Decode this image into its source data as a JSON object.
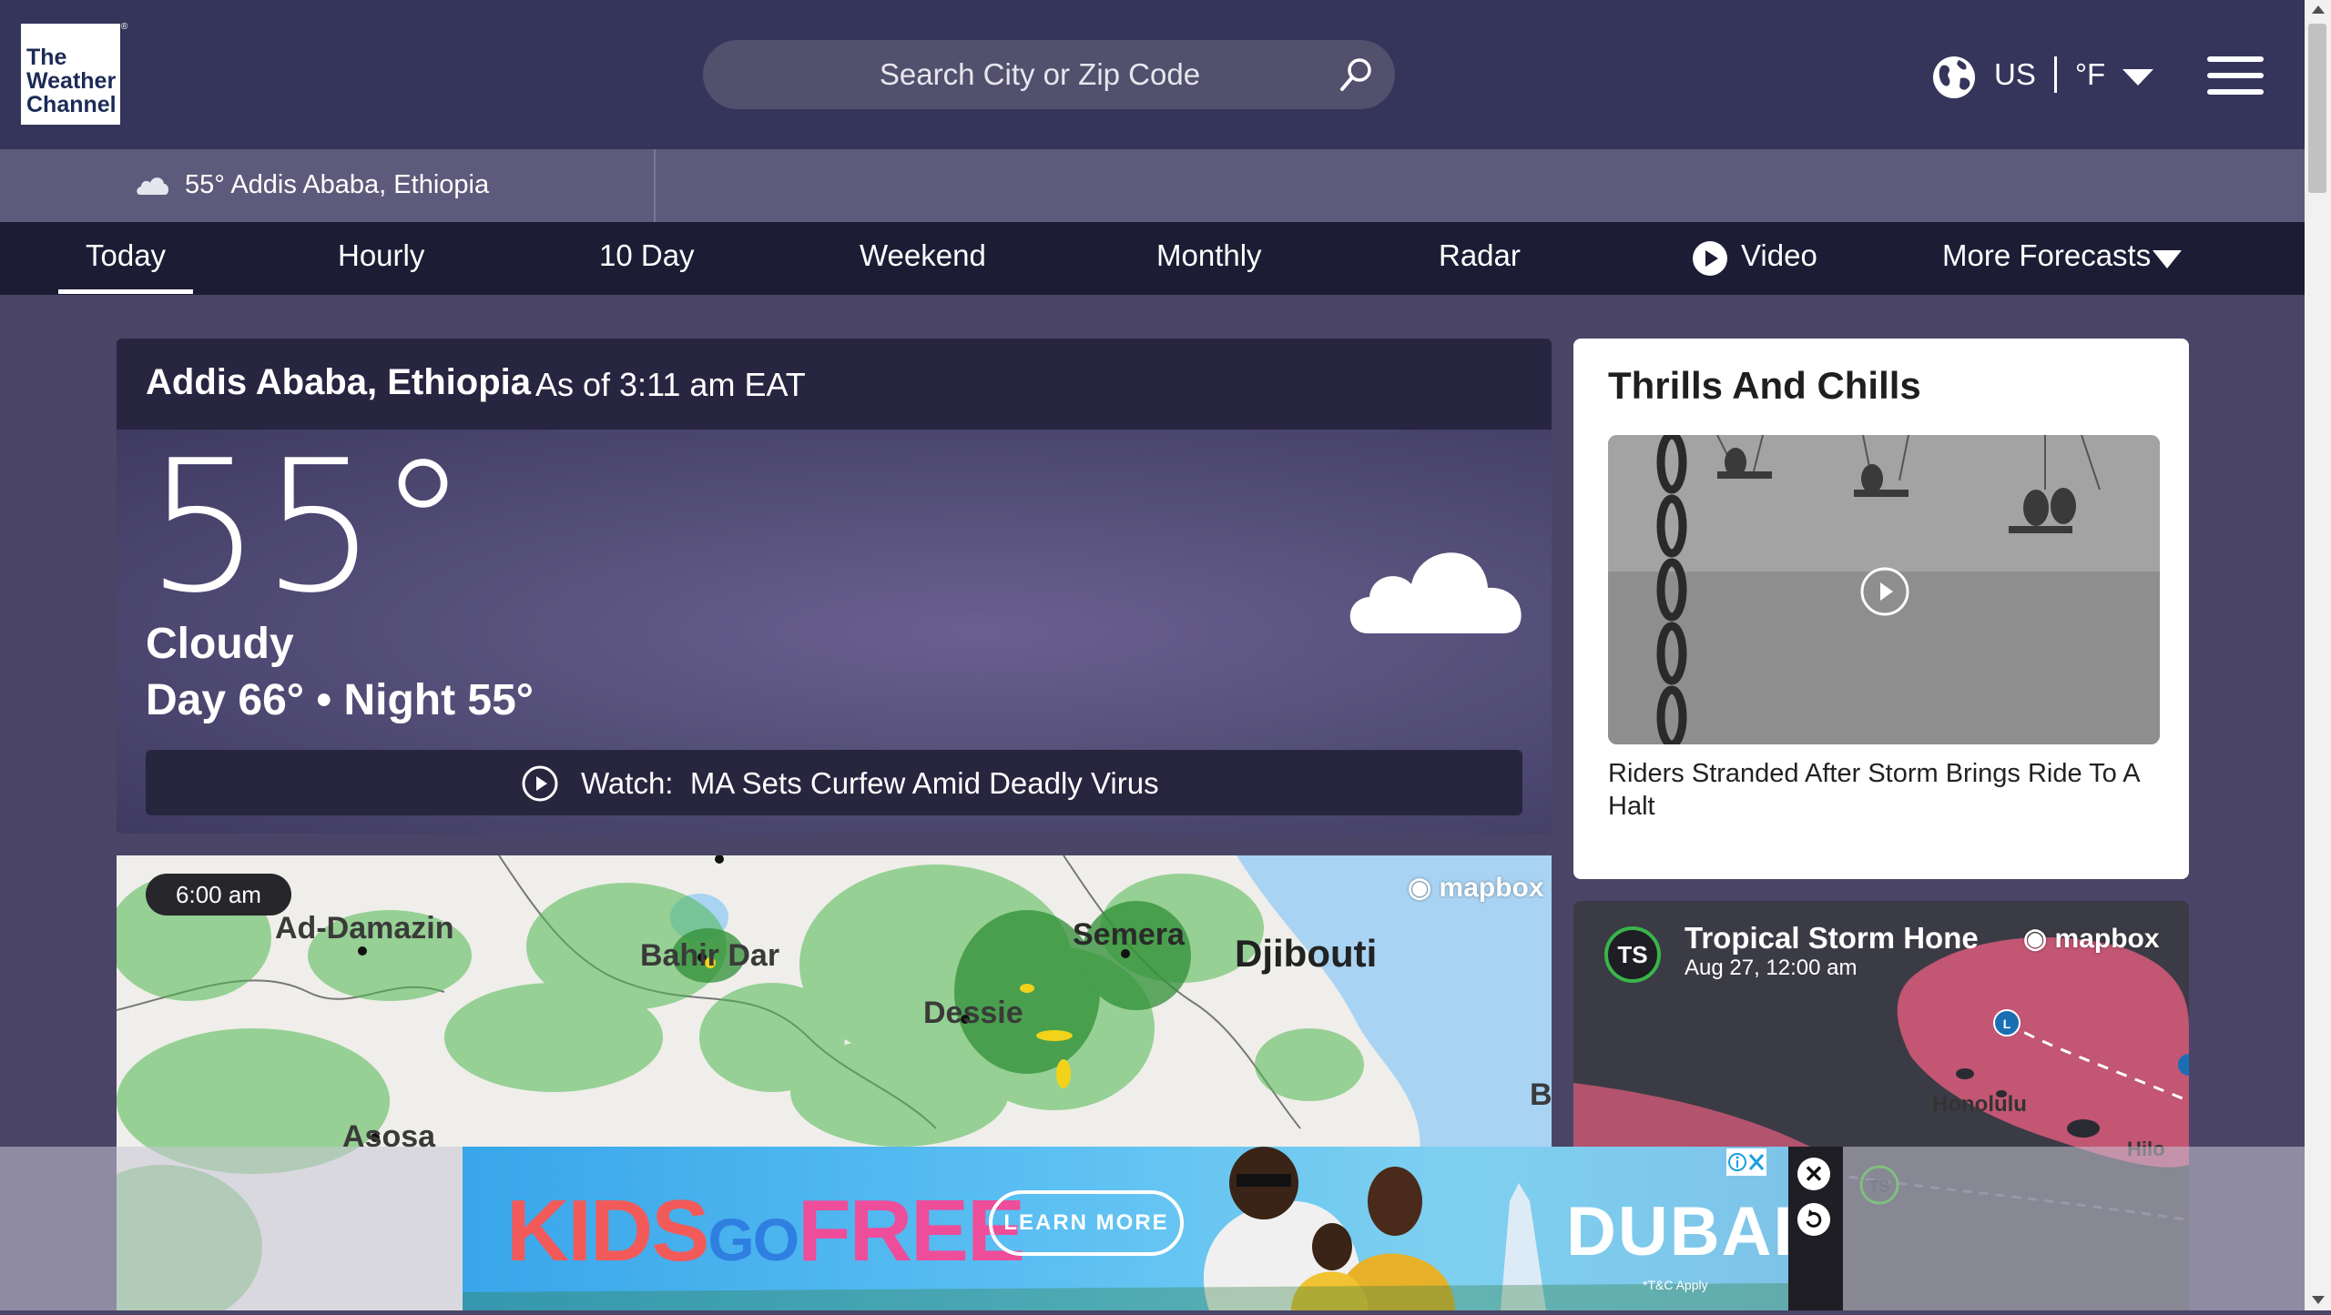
{
  "header": {
    "logo_lines": [
      "The",
      "Weather",
      "Channel"
    ],
    "logo_mark": "®",
    "search_placeholder": "Search City or Zip Code",
    "locale_region": "US",
    "locale_unit": "°F"
  },
  "location_bar": {
    "temp": "55°",
    "location": "Addis Ababa, Ethiopia"
  },
  "nav": {
    "items": [
      "Today",
      "Hourly",
      "10 Day",
      "Weekend",
      "Monthly",
      "Radar",
      "Video",
      "More Forecasts"
    ],
    "active": "Today"
  },
  "current": {
    "location": "Addis Ababa, Ethiopia",
    "as_of": "As of 3:11 am EAT",
    "temp": "55°",
    "phrase": "Cloudy",
    "day_night": "Day 66° • Night 55°",
    "watch_label": "Watch:",
    "watch_title": "MA Sets Curfew Amid Deadly Virus"
  },
  "radar_map": {
    "time": "6:00 am",
    "attribution": "mapbox",
    "cities": [
      "Ad-Damazin",
      "Bahir Dar",
      "Semera",
      "Djibouti",
      "Dessie",
      "Asosa",
      "B"
    ]
  },
  "video_card": {
    "title": "Thrills And Chills",
    "caption": "Riders Stranded After Storm Brings Ride To A Halt"
  },
  "storm_card": {
    "badge": "TS",
    "name": "Tropical Storm Hone",
    "date": "Aug 27, 12:00 am",
    "attribution": "mapbox",
    "map_labels": [
      "Honolulu",
      "Hilo"
    ],
    "marker_labels": [
      "L",
      "TS"
    ]
  },
  "ad": {
    "kids": "KIDS",
    "go": "GO",
    "free": "FREE",
    "cta": "LEARN MORE",
    "brand": "DUBAI",
    "fine_print": "*T&C Apply",
    "close": "✕"
  },
  "colors": {
    "header_bg": "#35345b",
    "nav_bg": "#1d1c35",
    "page_bg": "#4a4466",
    "storm_green": "#38b54a"
  }
}
